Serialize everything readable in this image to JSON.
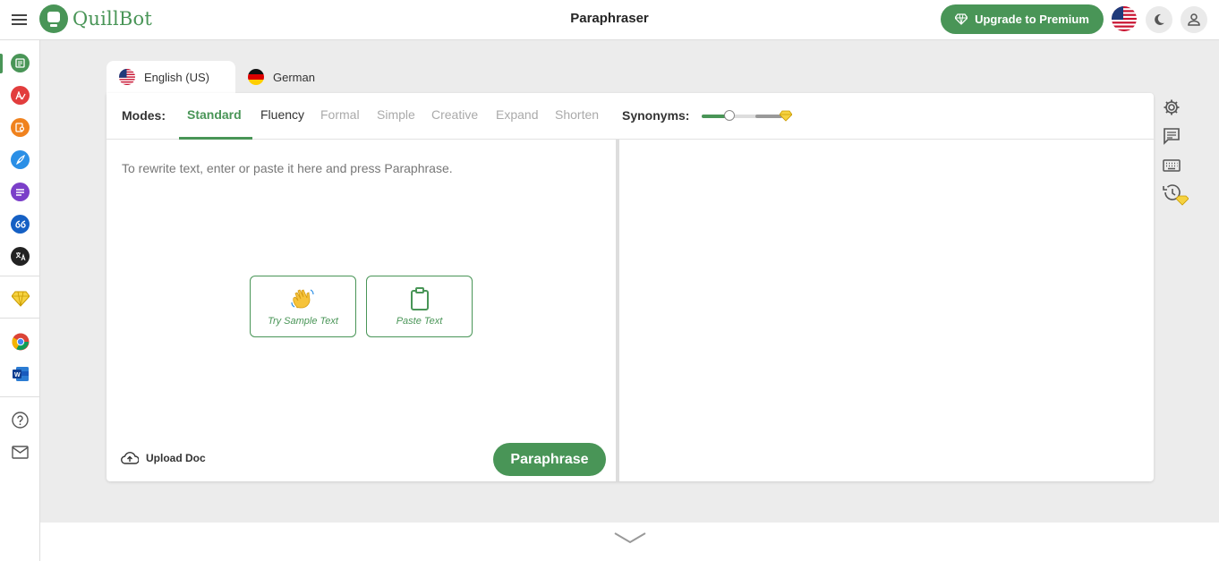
{
  "header": {
    "brand": "QuillBot",
    "page_title": "Paraphraser",
    "upgrade_label": "Upgrade to Premium"
  },
  "languages": [
    {
      "label": "English (US)",
      "active": true
    },
    {
      "label": "German",
      "active": false
    }
  ],
  "modes": {
    "label": "Modes:",
    "items": [
      "Standard",
      "Fluency",
      "Formal",
      "Simple",
      "Creative",
      "Expand",
      "Shorten"
    ],
    "selected": "Standard"
  },
  "synonyms": {
    "label": "Synonyms:",
    "level": 0.33
  },
  "editor": {
    "placeholder": "To rewrite text, enter or paste it here and press Paraphrase.",
    "sample_label": "Try Sample Text",
    "paste_label": "Paste Text",
    "upload_label": "Upload Doc",
    "paraphrase_label": "Paraphrase"
  },
  "colors": {
    "brand_green": "#499557",
    "premium_gold": "#e8b600"
  },
  "sidebar_icons": [
    "paraphraser-icon",
    "grammar-checker-icon",
    "plagiarism-checker-icon",
    "co-writer-icon",
    "summarizer-icon",
    "citation-generator-icon",
    "translator-icon",
    "premium-diamond-icon",
    "chrome-extension-icon",
    "word-addin-icon",
    "help-icon",
    "mail-icon"
  ],
  "tool_icons": [
    "settings-icon",
    "feedback-icon",
    "keyboard-icon",
    "history-icon"
  ]
}
